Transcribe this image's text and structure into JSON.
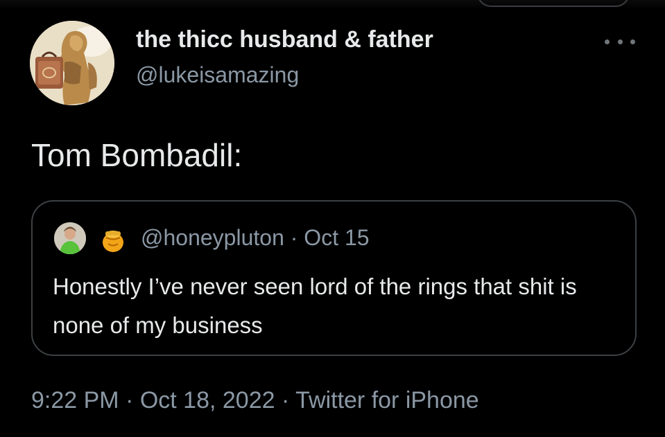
{
  "tweet": {
    "author": {
      "display_name": "the thicc husband & father",
      "handle": "@lukeisamazing",
      "avatar_icon": "avatar-statue-image"
    },
    "more_icon": "more-dots-icon",
    "text": "Tom Bombadil:",
    "quoted_tweet": {
      "handle": "@honeypluton",
      "separator": "·",
      "date": "Oct 15",
      "avatar_icon": "avatar-person-image",
      "emoji_icon": "honey-pot-emoji",
      "text": "Honestly I’ve never seen lord of the rings that shit is none of my business"
    },
    "timestamp": "9:22 PM · Oct 18, 2022 · Twitter for iPhone"
  },
  "colors": {
    "background": "#000000",
    "primary_text": "#e7e9ea",
    "secondary_text": "#8b98a5",
    "border": "#3d4144"
  }
}
